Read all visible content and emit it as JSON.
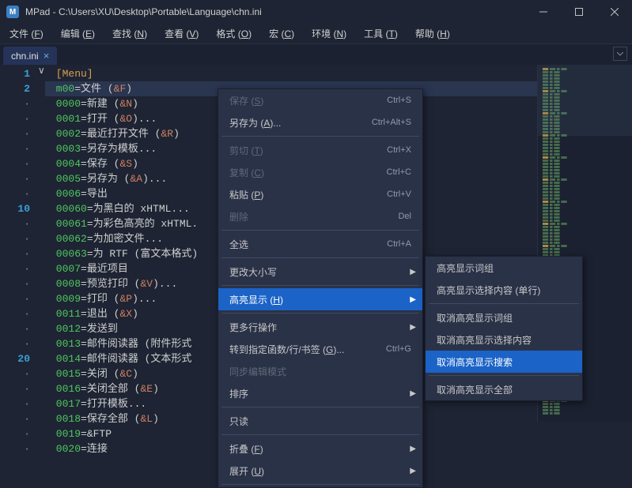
{
  "app": {
    "icon_letter": "M",
    "title": "MPad - C:\\Users\\XU\\Desktop\\Portable\\Language\\chn.ini"
  },
  "menubar": [
    {
      "label": "文件 (F)",
      "key": "F"
    },
    {
      "label": "编辑 (E)",
      "key": "E"
    },
    {
      "label": "查找 (N)",
      "key": "N"
    },
    {
      "label": "查看 (V)",
      "key": "V"
    },
    {
      "label": "格式 (O)",
      "key": "O"
    },
    {
      "label": "宏 (C)",
      "key": "C"
    },
    {
      "label": "环境 (N)",
      "key": "N"
    },
    {
      "label": "工具 (T)",
      "key": "T"
    },
    {
      "label": "帮助 (H)",
      "key": "H"
    }
  ],
  "tab": {
    "label": "chn.ini",
    "close": "×"
  },
  "lines": [
    {
      "n": "1",
      "type": "section",
      "text": "[Menu]"
    },
    {
      "n": "2",
      "type": "kv",
      "key": "m00",
      "val": "文件 (&F)",
      "current": true
    },
    {
      "n": "·",
      "type": "kv",
      "key": "0000",
      "val": "新建 (&N)"
    },
    {
      "n": "·",
      "type": "kv",
      "key": "0001",
      "val": "打开 (&O)..."
    },
    {
      "n": "·",
      "type": "kv",
      "key": "0002",
      "val": "最近打开文件 (&R)"
    },
    {
      "n": "·",
      "type": "kv",
      "key": "0003",
      "val": "另存为模板..."
    },
    {
      "n": "·",
      "type": "kv",
      "key": "0004",
      "val": "保存 (&S)"
    },
    {
      "n": "·",
      "type": "kv",
      "key": "0005",
      "val": "另存为 (&A)..."
    },
    {
      "n": "·",
      "type": "kv",
      "key": "0006",
      "val": "导出"
    },
    {
      "n": "10",
      "type": "kv",
      "key": "00060",
      "val": "为黑白的 xHTML..."
    },
    {
      "n": "·",
      "type": "kv",
      "key": "00061",
      "val": "为彩色高亮的 xHTML."
    },
    {
      "n": "·",
      "type": "kv",
      "key": "00062",
      "val": "为加密文件..."
    },
    {
      "n": "·",
      "type": "kv",
      "key": "00063",
      "val": "为 RTF (富文本格式)"
    },
    {
      "n": "·",
      "type": "kv",
      "key": "0007",
      "val": "最近项目"
    },
    {
      "n": "·",
      "type": "kv",
      "key": "0008",
      "val": "预览打印 (&V)..."
    },
    {
      "n": "·",
      "type": "kv",
      "key": "0009",
      "val": "打印 (&P)..."
    },
    {
      "n": "·",
      "type": "kv",
      "key": "0011",
      "val": "退出 (&X)"
    },
    {
      "n": "·",
      "type": "kv",
      "key": "0012",
      "val": "发送到"
    },
    {
      "n": "·",
      "type": "kv",
      "key": "0013",
      "val": "邮件阅读器 (附件形式"
    },
    {
      "n": "20",
      "type": "kv",
      "key": "0014",
      "val": "邮件阅读器 (文本形式"
    },
    {
      "n": "·",
      "type": "kv",
      "key": "0015",
      "val": "关闭 (&C)"
    },
    {
      "n": "·",
      "type": "kv",
      "key": "0016",
      "val": "关闭全部 (&E)"
    },
    {
      "n": "·",
      "type": "kv",
      "key": "0017",
      "val": "打开模板..."
    },
    {
      "n": "·",
      "type": "kv",
      "key": "0018",
      "val": "保存全部 (&L)"
    },
    {
      "n": "·",
      "type": "kv",
      "key": "0019",
      "val": "&FTP"
    },
    {
      "n": "·",
      "type": "kv",
      "key": "0020",
      "val": "连接"
    }
  ],
  "context_menu": {
    "items": [
      {
        "label": "保存 (S)",
        "shortcut": "Ctrl+S",
        "disabled": true
      },
      {
        "label": "另存为 (A)...",
        "shortcut": "Ctrl+Alt+S"
      },
      {
        "sep": true
      },
      {
        "label": "剪切 (T)",
        "shortcut": "Ctrl+X",
        "disabled": true
      },
      {
        "label": "复制 (C)",
        "shortcut": "Ctrl+C",
        "disabled": true
      },
      {
        "label": "粘贴 (P)",
        "shortcut": "Ctrl+V"
      },
      {
        "label": "删除",
        "shortcut": "Del",
        "disabled": true
      },
      {
        "sep": true
      },
      {
        "label": "全选",
        "shortcut": "Ctrl+A"
      },
      {
        "sep": true
      },
      {
        "label": "更改大小写",
        "arrow": true
      },
      {
        "sep": true
      },
      {
        "label": "高亮显示 (H)",
        "arrow": true,
        "highlighted": true
      },
      {
        "sep": true
      },
      {
        "label": "更多行操作",
        "arrow": true
      },
      {
        "label": "转到指定函数/行/书签 (G)...",
        "shortcut": "Ctrl+G"
      },
      {
        "label": "同步编辑模式",
        "disabled": true
      },
      {
        "label": "排序",
        "arrow": true
      },
      {
        "sep": true
      },
      {
        "label": "只读"
      },
      {
        "sep": true
      },
      {
        "label": "折叠 (F)",
        "arrow": true
      },
      {
        "label": "展开 (U)",
        "arrow": true
      },
      {
        "sep": true
      }
    ],
    "submenu": [
      {
        "label": "高亮显示词组"
      },
      {
        "label": "高亮显示选择内容 (单行)"
      },
      {
        "sep": true
      },
      {
        "label": "取消高亮显示词组"
      },
      {
        "label": "取消高亮显示选择内容"
      },
      {
        "label": "取消高亮显示搜索",
        "highlighted": true
      },
      {
        "sep": true
      },
      {
        "label": "取消高亮显示全部"
      }
    ]
  }
}
